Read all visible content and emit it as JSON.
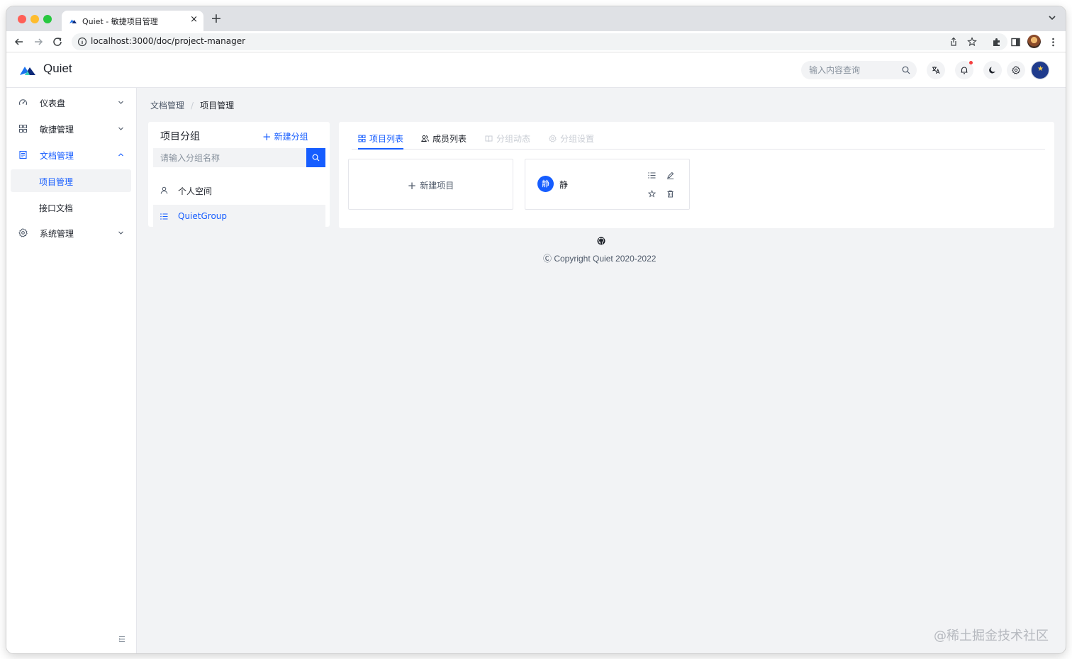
{
  "browser": {
    "tab_title": "Quiet - 敏捷项目管理",
    "tab_close": "×",
    "new_tab": "+",
    "url": "localhost:3000/doc/project-manager"
  },
  "header": {
    "brand": "Quiet",
    "search_placeholder": "输入内容查询",
    "avatar_glyph": "★"
  },
  "sidebar": {
    "items": [
      {
        "label": "仪表盘",
        "icon": "dashboard-icon",
        "expanded": false
      },
      {
        "label": "敏捷管理",
        "icon": "grid-icon",
        "expanded": false
      },
      {
        "label": "文档管理",
        "icon": "document-icon",
        "expanded": true
      },
      {
        "label": "系统管理",
        "icon": "gear-icon",
        "expanded": false
      }
    ],
    "sub_items": [
      {
        "label": "项目管理",
        "selected": true
      },
      {
        "label": "接口文档",
        "selected": false
      }
    ]
  },
  "breadcrumb": {
    "root": "文档管理",
    "separator": "/",
    "current": "项目管理"
  },
  "groups": {
    "title": "项目分组",
    "new_plus": "+",
    "new_label": "新建分组",
    "search_placeholder": "请输入分组名称",
    "items": [
      {
        "label": "个人空间",
        "icon": "user-icon",
        "selected": false
      },
      {
        "label": "QuietGroup",
        "icon": "list-icon",
        "selected": true
      }
    ]
  },
  "tabs": [
    {
      "label": "项目列表",
      "state": "active"
    },
    {
      "label": "成员列表",
      "state": "normal"
    },
    {
      "label": "分组动态",
      "state": "disabled"
    },
    {
      "label": "分组设置",
      "state": "disabled"
    }
  ],
  "projects": {
    "new_plus": "+",
    "new_label": "新建项目",
    "items": [
      {
        "avatar": "静",
        "name": "静"
      }
    ]
  },
  "footer": {
    "copyright": "Ⓒ Copyright Quiet 2020-2022"
  },
  "watermark": "@稀土掘金技术社区",
  "colors": {
    "primary": "#165dff",
    "text": "#1d2129",
    "muted": "#86909c",
    "background": "#f2f3f5",
    "notify": "#f53f3f"
  }
}
